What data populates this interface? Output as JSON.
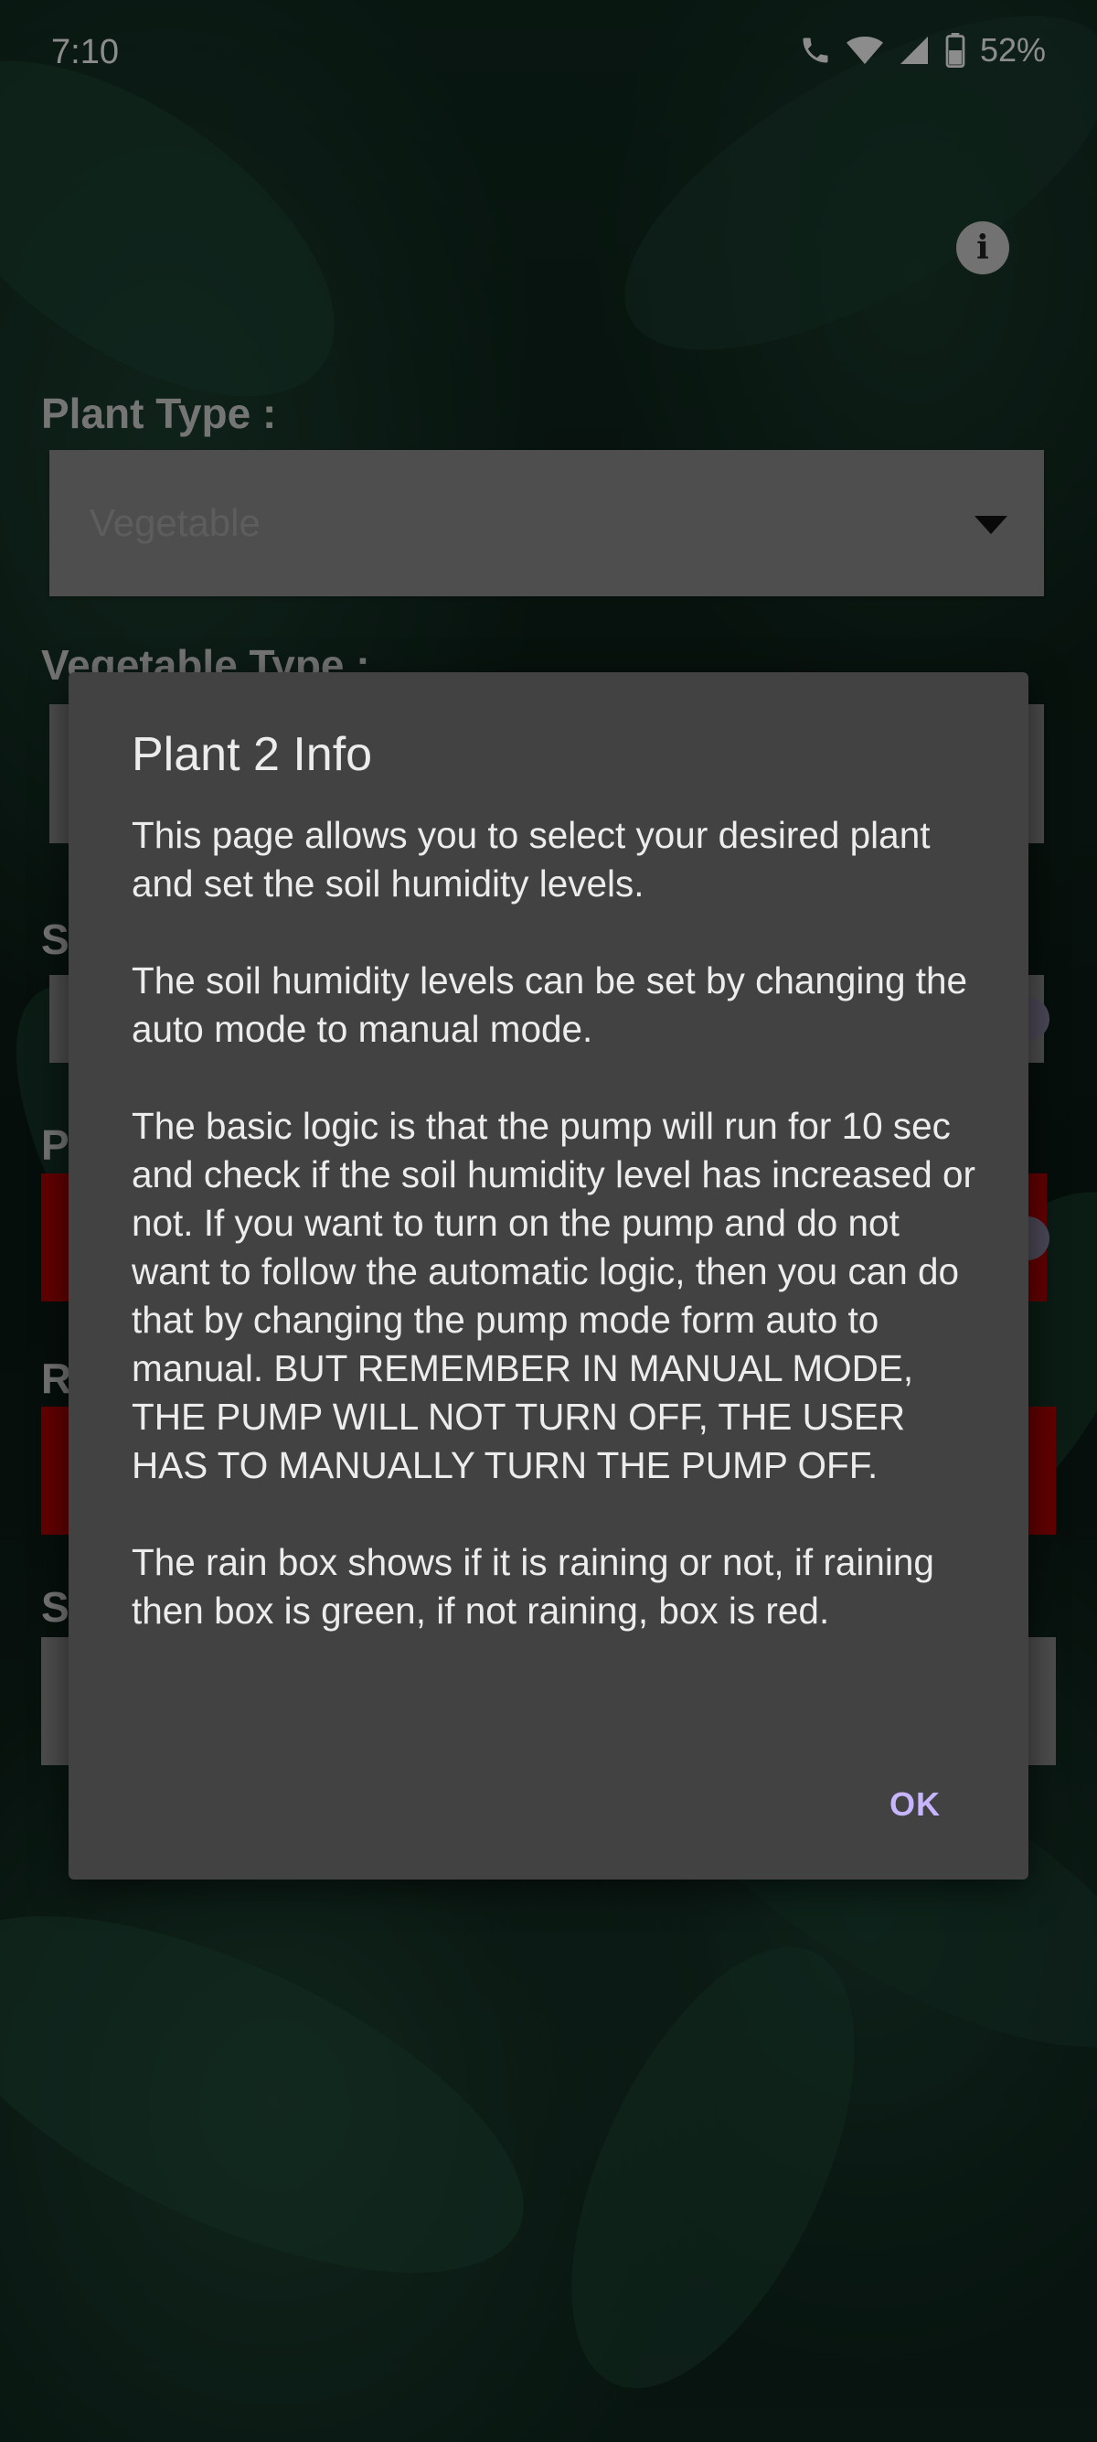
{
  "status_bar": {
    "time": "7:10",
    "battery": "52%"
  },
  "screen": {
    "plant_type_label": "Plant Type :",
    "plant_type_value": "Vegetable",
    "vegetable_type_label": "Vegetable Type :",
    "partial_labels": [
      "S",
      "P",
      "R",
      "S"
    ]
  },
  "dialog": {
    "title": "Plant 2 Info",
    "message": "This page allows you to select your desired plant and set the soil humidity levels.\n\nThe soil humidity levels can be set by changing the auto mode to manual mode.\n\nThe basic logic is that the pump will run for 10 sec and check if the soil humidity level has increased or not. If you want to turn on the pump and do not want to follow the automatic logic, then you can do that by changing the pump mode form auto to manual. BUT REMEMBER IN MANUAL MODE, THE PUMP WILL NOT TURN OFF, THE USER HAS TO MANUALLY TURN THE PUMP OFF.\n\nThe rain box shows if it is raining or not, if raining then box is green, if not raining, box is red.",
    "ok_label": "OK"
  },
  "colors": {
    "rain_box": "#b40000",
    "accent": "#c8b5ff"
  }
}
